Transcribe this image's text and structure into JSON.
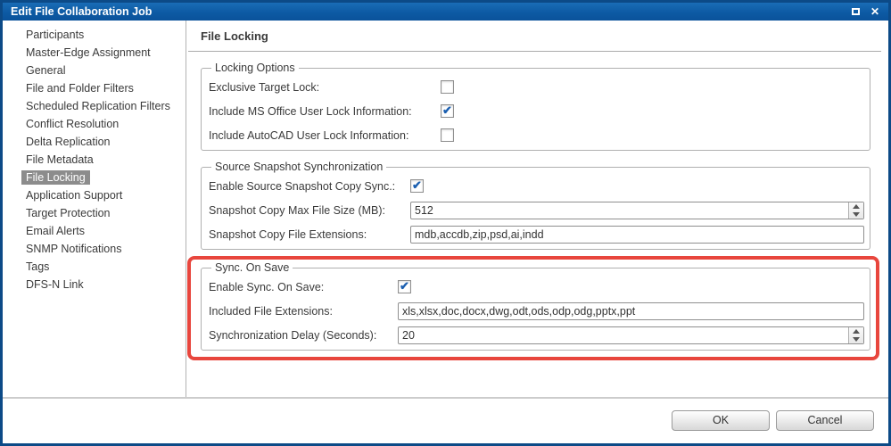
{
  "window": {
    "title": "Edit File Collaboration Job",
    "close_glyph": "✕"
  },
  "icons": {
    "checkmark": "✔"
  },
  "colors": {
    "titlebar_blue": "#0d5aa4",
    "window_border_blue": "#0c4a87",
    "selected_item_gray": "#8c8c8c",
    "highlight_red": "#e8463d",
    "checkbox_check_blue": "#1b5fb0"
  },
  "sidebar": {
    "items": [
      {
        "label": "Participants",
        "selected": false
      },
      {
        "label": "Master-Edge Assignment",
        "selected": false
      },
      {
        "label": "General",
        "selected": false
      },
      {
        "label": "File and Folder Filters",
        "selected": false
      },
      {
        "label": "Scheduled Replication Filters",
        "selected": false
      },
      {
        "label": "Conflict Resolution",
        "selected": false
      },
      {
        "label": "Delta Replication",
        "selected": false
      },
      {
        "label": "File Metadata",
        "selected": false
      },
      {
        "label": "File Locking",
        "selected": true
      },
      {
        "label": "Application Support",
        "selected": false
      },
      {
        "label": "Target Protection",
        "selected": false
      },
      {
        "label": "Email Alerts",
        "selected": false
      },
      {
        "label": "SNMP Notifications",
        "selected": false
      },
      {
        "label": "Tags",
        "selected": false
      },
      {
        "label": "DFS-N Link",
        "selected": false
      }
    ]
  },
  "main": {
    "title": "File Locking",
    "sections": [
      {
        "legend": "Locking Options",
        "highlighted": false,
        "rows": [
          {
            "label": "Exclusive Target Lock:",
            "control": "checkbox",
            "checked": false
          },
          {
            "label": "Include MS Office User Lock Information:",
            "control": "checkbox",
            "checked": true
          },
          {
            "label": "Include AutoCAD User Lock Information:",
            "control": "checkbox",
            "checked": false
          }
        ]
      },
      {
        "legend": "Source Snapshot Synchronization",
        "highlighted": false,
        "rows": [
          {
            "label": "Enable Source Snapshot Copy Sync.:",
            "control": "checkbox",
            "checked": true
          },
          {
            "label": "Snapshot Copy Max File Size (MB):",
            "control": "spinner",
            "value": "512"
          },
          {
            "label": "Snapshot Copy File Extensions:",
            "control": "text",
            "value": "mdb,accdb,zip,psd,ai,indd"
          }
        ]
      },
      {
        "legend": "Sync. On Save",
        "highlighted": true,
        "rows": [
          {
            "label": "Enable Sync. On Save:",
            "control": "checkbox",
            "checked": true
          },
          {
            "label": "Included File Extensions:",
            "control": "text",
            "value": "xls,xlsx,doc,docx,dwg,odt,ods,odp,odg,pptx,ppt"
          },
          {
            "label": "Synchronization Delay (Seconds):",
            "control": "spinner",
            "value": "20"
          }
        ]
      }
    ]
  },
  "footer": {
    "ok_label": "OK",
    "cancel_label": "Cancel"
  }
}
